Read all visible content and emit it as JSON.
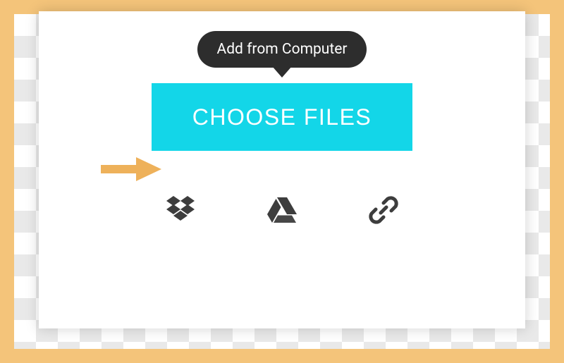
{
  "tooltip": {
    "label": "Add from Computer"
  },
  "choose_button": {
    "label": "CHOOSE FILES"
  },
  "sources": {
    "dropbox": {
      "name": "dropbox-icon"
    },
    "gdrive": {
      "name": "google-drive-icon"
    },
    "link": {
      "name": "link-icon"
    }
  },
  "colors": {
    "frame": "#f4c47a",
    "accent": "#13d6e8",
    "tooltip_bg": "#2d2d2d",
    "icon": "#3d3d3d",
    "arrow": "#eeb15a"
  }
}
